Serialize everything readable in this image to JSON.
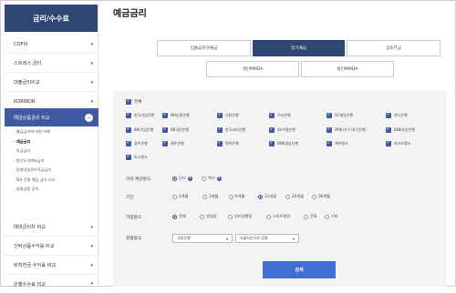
{
  "sidebar": {
    "header": "금리/수수료",
    "items": [
      {
        "label": "COFIX"
      },
      {
        "label": "스트레스 금리"
      },
      {
        "label": "대출금리비교"
      },
      {
        "label": "KORIBOR"
      },
      {
        "label": "예금상품금리 비교"
      }
    ],
    "sub_items": [
      "예금금리에 대한 이해",
      "예금금리",
      "적금금리",
      "청년도약계좌금리",
      "장병내일준비적금금리",
      "ISA 전용 예금 금리 비교",
      "맞춤상품 검색"
    ],
    "bottom_items": [
      {
        "label": "예대금리차 비교"
      },
      {
        "label": "신탁상품수익률 비교"
      },
      {
        "label": "퇴직연금 수익률 비교"
      },
      {
        "label": "은행수수료 비교"
      }
    ]
  },
  "page": {
    "title": "예금금리"
  },
  "tabs_row1": [
    "입출금자유예금",
    "정기예금",
    "상호부금"
  ],
  "tabs_row2": [
    "개인MMDA",
    "법인MMDA"
  ],
  "filters": {
    "all_label": "전체",
    "banks": [
      "한국산업은행",
      "NH농협은행",
      "신한은행",
      "우리은행",
      "SC제일은행",
      "하나은행",
      "IBK기업은행",
      "KB국민은행",
      "한국씨티은행",
      "Sh수협은행",
      "iM뱅크(구 대구은행)",
      "BNK부산은행",
      "광주은행",
      "제주은행",
      "전북은행",
      "BNK경남은행",
      "케이뱅크",
      "카카오뱅크",
      "토스뱅크"
    ],
    "interest_label": "이자 계산방식",
    "interest_options": [
      "단리",
      "복리"
    ],
    "term_label": "기간",
    "term_options": [
      "1개월",
      "3개월",
      "6개월",
      "12개월",
      "24개월",
      "36개월"
    ],
    "org_label": "가입방식",
    "org_options": [
      "전체",
      "영업점",
      "인터넷뱅킹",
      "스마트뱅킹",
      "전화",
      "기타"
    ],
    "sort_label": "정렬방식",
    "sort_select1": "사용은행",
    "sort_select2": "오름차순으로 정렬",
    "search_label": "검색"
  }
}
